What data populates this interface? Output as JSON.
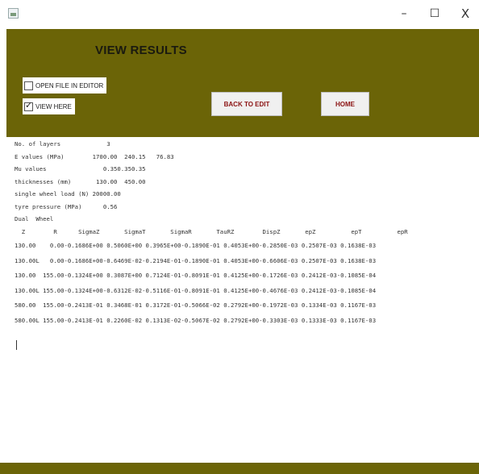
{
  "window": {
    "icon": "java-app-icon",
    "minimize": "–",
    "maximize": "☐",
    "close": "X"
  },
  "header": {
    "title": "VIEW RESULTS",
    "open_file_label": "OPEN FILE IN EDITOR",
    "open_file_checked": false,
    "view_here_label": "VIEW HERE",
    "view_here_checked": true,
    "back_button": "BACK TO EDIT",
    "home_button": "HOME"
  },
  "colors": {
    "panel": "#6b6407",
    "button_text": "#8b1212"
  },
  "output": {
    "lines": [
      "No. of layers             3",
      "E values (MPa)        1700.00  240.15   76.83",
      "Mu values                0.350.350.35",
      "thicknesses (mm)       130.00  450.00",
      "single wheel load (N) 20000.00",
      "tyre pressure (MPa)      0.56",
      "Dual  Wheel",
      "  Z        R      SigmaZ       SigmaT       SigmaR       TauRZ        DispZ       epZ          epT          epR",
      "130.00    0.00-0.1686E+00 0.5060E+00 0.3965E+00-0.1890E-01 0.4053E+00-0.2850E-03 0.2507E-03 0.1638E-03",
      "130.00L   0.00-0.1686E+00-0.6469E-02-0.2194E-01-0.1890E-01 0.4053E+00-0.6606E-03 0.2507E-03 0.1638E-03",
      "130.00  155.00-0.1324E+00 0.3087E+00 0.7124E-01-0.8091E-01 0.4125E+00-0.1726E-03 0.2412E-03-0.1085E-04",
      "130.00L 155.00-0.1324E+00-0.6312E-02-0.5116E-01-0.8091E-01 0.4125E+00-0.4676E-03 0.2412E-03-0.1085E-04",
      "580.00  155.00-0.2413E-01 0.3468E-01 0.3172E-01-0.5066E-02 0.2792E+00-0.1972E-03 0.1334E-03 0.1167E-03",
      "580.00L 155.00-0.2413E-01 0.2260E-02 0.1313E-02-0.5067E-02 0.2792E+00-0.3303E-03 0.1333E-03 0.1167E-03"
    ]
  }
}
